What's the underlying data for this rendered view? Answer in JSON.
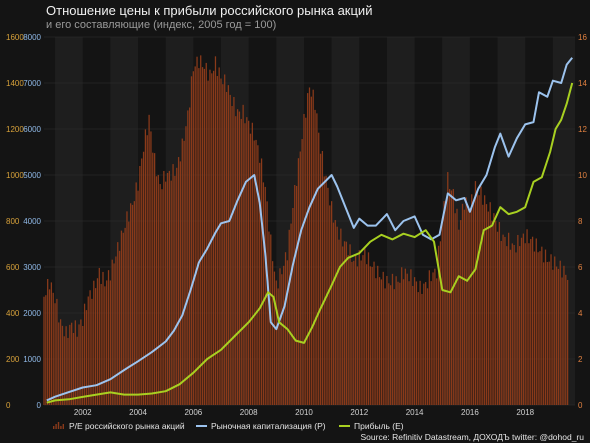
{
  "header": {
    "title": "Отношение цены к прибыли российского рынка акций",
    "subtitle": "и его составляющие (индекс, 2005 год = 100)"
  },
  "colors": {
    "background": "#141414",
    "plot_band": "#1e1e1e",
    "grid": "#303030",
    "pe_bars": "#8a3a1a",
    "market_cap": "#9cc3ee",
    "earnings": "#a8d021",
    "axis_left_outer": "#d7a13a",
    "axis_left_inner": "#8fb8e6",
    "axis_right": "#e08040",
    "x_axis": "#d0d0d0"
  },
  "footer": {
    "source": "Source: Refinitiv Datastream, ДОХОДЪ twitter: @dohod_ru"
  },
  "chart_data": {
    "type": "bar+line",
    "title": "Отношение цены к прибыли российского рынка акций",
    "subtitle": "и его составляющие (индекс, 2005 год = 100)",
    "x_ticks": [
      "2002",
      "2004",
      "2006",
      "2008",
      "2010",
      "2012",
      "2014",
      "2016",
      "2018"
    ],
    "x_range": [
      2000.6,
      2019.8
    ],
    "axes": {
      "left_outer": {
        "series": "Прибыль (E)",
        "range": [
          0,
          1600
        ],
        "ticks": [
          "0",
          "200",
          "400",
          "600",
          "800",
          "1000",
          "1200",
          "1400",
          "1600"
        ]
      },
      "left_inner": {
        "series": "Рыночная капитализация (P)",
        "range": [
          0,
          8000
        ],
        "ticks": [
          "0",
          "1000",
          "2000",
          "3000",
          "4000",
          "5000",
          "6000",
          "7000",
          "8000"
        ]
      },
      "right": {
        "series": "P/E российского рынка акций",
        "range": [
          0,
          16
        ],
        "ticks": [
          "0",
          "2",
          "4",
          "6",
          "8",
          "10",
          "12",
          "14",
          "16"
        ]
      }
    },
    "legend_position": "bottom",
    "grid": true,
    "series": [
      {
        "name": "P/E российского рынка акций",
        "type": "bar",
        "axis": "right",
        "points": [
          [
            2000.6,
            5.0
          ],
          [
            2000.8,
            5.6
          ],
          [
            2001.0,
            4.8
          ],
          [
            2001.2,
            3.6
          ],
          [
            2001.4,
            3.0
          ],
          [
            2001.6,
            3.3
          ],
          [
            2001.8,
            3.0
          ],
          [
            2002.0,
            3.5
          ],
          [
            2002.2,
            4.5
          ],
          [
            2002.4,
            5.0
          ],
          [
            2002.6,
            5.8
          ],
          [
            2002.8,
            5.5
          ],
          [
            2003.0,
            6.0
          ],
          [
            2003.2,
            6.8
          ],
          [
            2003.4,
            7.5
          ],
          [
            2003.6,
            8.2
          ],
          [
            2003.8,
            8.7
          ],
          [
            2004.0,
            9.5
          ],
          [
            2004.2,
            11.0
          ],
          [
            2004.4,
            12.2
          ],
          [
            2004.6,
            10.4
          ],
          [
            2004.8,
            9.4
          ],
          [
            2005.0,
            10.0
          ],
          [
            2005.2,
            10.2
          ],
          [
            2005.4,
            10.5
          ],
          [
            2005.6,
            11.5
          ],
          [
            2005.8,
            12.8
          ],
          [
            2006.0,
            14.8
          ],
          [
            2006.2,
            15.0
          ],
          [
            2006.4,
            14.6
          ],
          [
            2006.6,
            14.1
          ],
          [
            2006.8,
            14.6
          ],
          [
            2007.0,
            14.0
          ],
          [
            2007.2,
            13.8
          ],
          [
            2007.4,
            13.2
          ],
          [
            2007.6,
            12.8
          ],
          [
            2007.8,
            12.9
          ],
          [
            2008.0,
            12.5
          ],
          [
            2008.2,
            12.0
          ],
          [
            2008.4,
            11.0
          ],
          [
            2008.6,
            9.5
          ],
          [
            2008.8,
            7.0
          ],
          [
            2009.0,
            5.0
          ],
          [
            2009.2,
            5.6
          ],
          [
            2009.4,
            6.4
          ],
          [
            2009.6,
            8.5
          ],
          [
            2009.8,
            10.4
          ],
          [
            2010.0,
            12.4
          ],
          [
            2010.2,
            14.0
          ],
          [
            2010.4,
            13.4
          ],
          [
            2010.6,
            11.4
          ],
          [
            2010.8,
            10.0
          ],
          [
            2011.0,
            8.6
          ],
          [
            2011.2,
            7.6
          ],
          [
            2011.4,
            7.0
          ],
          [
            2011.6,
            6.6
          ],
          [
            2011.8,
            6.0
          ],
          [
            2012.0,
            6.2
          ],
          [
            2012.2,
            6.5
          ],
          [
            2012.4,
            6.2
          ],
          [
            2012.6,
            6.0
          ],
          [
            2012.8,
            5.8
          ],
          [
            2013.0,
            5.6
          ],
          [
            2013.2,
            5.6
          ],
          [
            2013.4,
            5.5
          ],
          [
            2013.6,
            5.8
          ],
          [
            2013.8,
            5.5
          ],
          [
            2014.0,
            5.2
          ],
          [
            2014.2,
            4.8
          ],
          [
            2014.4,
            5.0
          ],
          [
            2014.6,
            5.5
          ],
          [
            2014.8,
            5.8
          ],
          [
            2015.0,
            8.2
          ],
          [
            2015.2,
            10.0
          ],
          [
            2015.4,
            9.4
          ],
          [
            2015.6,
            8.0
          ],
          [
            2015.8,
            9.0
          ],
          [
            2016.0,
            8.6
          ],
          [
            2016.2,
            9.4
          ],
          [
            2016.4,
            9.0
          ],
          [
            2016.6,
            8.5
          ],
          [
            2016.8,
            8.1
          ],
          [
            2017.0,
            7.6
          ],
          [
            2017.2,
            7.2
          ],
          [
            2017.4,
            7.2
          ],
          [
            2017.6,
            7.0
          ],
          [
            2017.8,
            7.4
          ],
          [
            2018.0,
            7.6
          ],
          [
            2018.2,
            7.4
          ],
          [
            2018.4,
            7.0
          ],
          [
            2018.6,
            6.6
          ],
          [
            2018.8,
            6.2
          ],
          [
            2019.0,
            6.0
          ],
          [
            2019.2,
            5.8
          ],
          [
            2019.4,
            5.6
          ],
          [
            2019.6,
            5.4
          ]
        ]
      },
      {
        "name": "Рыночная капитализация (P)",
        "type": "line",
        "axis": "left_inner",
        "points": [
          [
            2000.7,
            100
          ],
          [
            2001.0,
            180
          ],
          [
            2001.5,
            280
          ],
          [
            2002.0,
            380
          ],
          [
            2002.5,
            430
          ],
          [
            2003.0,
            560
          ],
          [
            2003.5,
            760
          ],
          [
            2004.0,
            950
          ],
          [
            2004.5,
            1150
          ],
          [
            2005.0,
            1380
          ],
          [
            2005.3,
            1620
          ],
          [
            2005.6,
            1950
          ],
          [
            2005.9,
            2500
          ],
          [
            2006.2,
            3100
          ],
          [
            2006.5,
            3400
          ],
          [
            2006.8,
            3750
          ],
          [
            2007.0,
            3950
          ],
          [
            2007.3,
            4000
          ],
          [
            2007.6,
            4450
          ],
          [
            2007.9,
            4850
          ],
          [
            2008.2,
            5000
          ],
          [
            2008.4,
            4400
          ],
          [
            2008.6,
            3300
          ],
          [
            2008.8,
            1800
          ],
          [
            2009.0,
            1650
          ],
          [
            2009.3,
            2150
          ],
          [
            2009.6,
            3050
          ],
          [
            2009.9,
            3800
          ],
          [
            2010.2,
            4300
          ],
          [
            2010.5,
            4700
          ],
          [
            2011.0,
            5000
          ],
          [
            2011.2,
            4750
          ],
          [
            2011.5,
            4300
          ],
          [
            2011.8,
            3850
          ],
          [
            2012.0,
            4050
          ],
          [
            2012.3,
            3900
          ],
          [
            2012.6,
            3900
          ],
          [
            2013.0,
            4150
          ],
          [
            2013.3,
            3800
          ],
          [
            2013.6,
            4000
          ],
          [
            2014.0,
            4100
          ],
          [
            2014.3,
            3700
          ],
          [
            2014.6,
            3600
          ],
          [
            2014.9,
            3700
          ],
          [
            2015.2,
            4600
          ],
          [
            2015.5,
            4450
          ],
          [
            2015.8,
            4500
          ],
          [
            2016.0,
            4200
          ],
          [
            2016.3,
            4700
          ],
          [
            2016.6,
            5000
          ],
          [
            2016.9,
            5600
          ],
          [
            2017.1,
            5900
          ],
          [
            2017.4,
            5400
          ],
          [
            2017.7,
            5800
          ],
          [
            2018.0,
            6100
          ],
          [
            2018.3,
            6150
          ],
          [
            2018.5,
            6800
          ],
          [
            2018.8,
            6700
          ],
          [
            2019.0,
            7050
          ],
          [
            2019.3,
            7000
          ],
          [
            2019.5,
            7400
          ],
          [
            2019.7,
            7550
          ]
        ]
      },
      {
        "name": "Прибыль (E)",
        "type": "line",
        "axis": "left_outer",
        "points": [
          [
            2000.7,
            10
          ],
          [
            2001.0,
            20
          ],
          [
            2001.5,
            25
          ],
          [
            2002.0,
            35
          ],
          [
            2002.5,
            45
          ],
          [
            2003.0,
            55
          ],
          [
            2003.5,
            45
          ],
          [
            2004.0,
            45
          ],
          [
            2004.5,
            50
          ],
          [
            2005.0,
            60
          ],
          [
            2005.5,
            90
          ],
          [
            2006.0,
            140
          ],
          [
            2006.5,
            200
          ],
          [
            2007.0,
            240
          ],
          [
            2007.5,
            300
          ],
          [
            2008.0,
            360
          ],
          [
            2008.4,
            420
          ],
          [
            2008.7,
            490
          ],
          [
            2008.9,
            470
          ],
          [
            2009.1,
            360
          ],
          [
            2009.4,
            330
          ],
          [
            2009.7,
            280
          ],
          [
            2010.0,
            270
          ],
          [
            2010.3,
            340
          ],
          [
            2010.6,
            420
          ],
          [
            2011.0,
            520
          ],
          [
            2011.3,
            600
          ],
          [
            2011.6,
            640
          ],
          [
            2012.0,
            660
          ],
          [
            2012.4,
            710
          ],
          [
            2012.8,
            740
          ],
          [
            2013.2,
            720
          ],
          [
            2013.6,
            745
          ],
          [
            2014.0,
            730
          ],
          [
            2014.4,
            760
          ],
          [
            2014.7,
            710
          ],
          [
            2015.0,
            500
          ],
          [
            2015.3,
            490
          ],
          [
            2015.6,
            560
          ],
          [
            2015.9,
            540
          ],
          [
            2016.2,
            590
          ],
          [
            2016.5,
            760
          ],
          [
            2016.8,
            780
          ],
          [
            2017.1,
            860
          ],
          [
            2017.4,
            830
          ],
          [
            2017.7,
            840
          ],
          [
            2018.0,
            860
          ],
          [
            2018.3,
            970
          ],
          [
            2018.6,
            990
          ],
          [
            2018.9,
            1100
          ],
          [
            2019.1,
            1200
          ],
          [
            2019.3,
            1240
          ],
          [
            2019.5,
            1310
          ],
          [
            2019.7,
            1400
          ]
        ]
      }
    ]
  }
}
